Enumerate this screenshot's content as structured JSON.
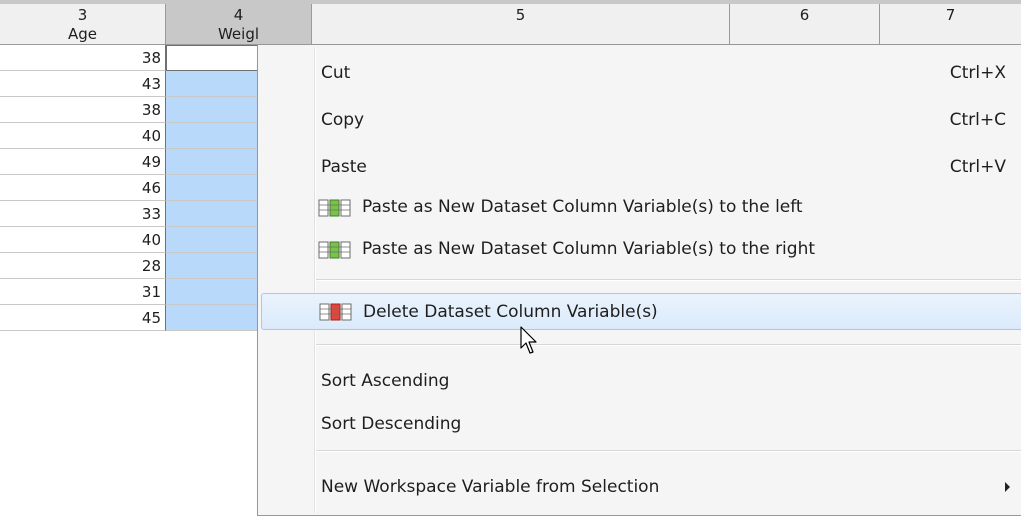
{
  "grid": {
    "columns": [
      {
        "num": "3",
        "name": "Age"
      },
      {
        "num": "4",
        "name": "Weigl"
      },
      {
        "num": "5",
        "name": ""
      },
      {
        "num": "6",
        "name": ""
      },
      {
        "num": "7",
        "name": ""
      }
    ],
    "age_values": [
      "38",
      "43",
      "38",
      "40",
      "49",
      "46",
      "33",
      "40",
      "28",
      "31",
      "45"
    ]
  },
  "context_menu": {
    "cut": {
      "label": "Cut",
      "shortcut": "Ctrl+X"
    },
    "copy": {
      "label": "Copy",
      "shortcut": "Ctrl+C"
    },
    "paste": {
      "label": "Paste",
      "shortcut": "Ctrl+V"
    },
    "paste_left": {
      "label": "Paste as New Dataset Column Variable(s) to the left",
      "icon": "green-columns-icon"
    },
    "paste_right": {
      "label": "Paste as New Dataset Column Variable(s) to the right",
      "icon": "green-columns-icon"
    },
    "delete_cols": {
      "label": "Delete Dataset Column Variable(s)",
      "icon": "red-columns-icon"
    },
    "sort_asc": {
      "label": "Sort Ascending"
    },
    "sort_desc": {
      "label": "Sort Descending"
    },
    "new_var": {
      "label": "New Workspace Variable from Selection",
      "icon": "submenu-arrow-icon"
    }
  },
  "colors": {
    "selection": "#b9d9fb",
    "menu_highlight": "#dbeafb",
    "header": "#f0f0f0"
  }
}
